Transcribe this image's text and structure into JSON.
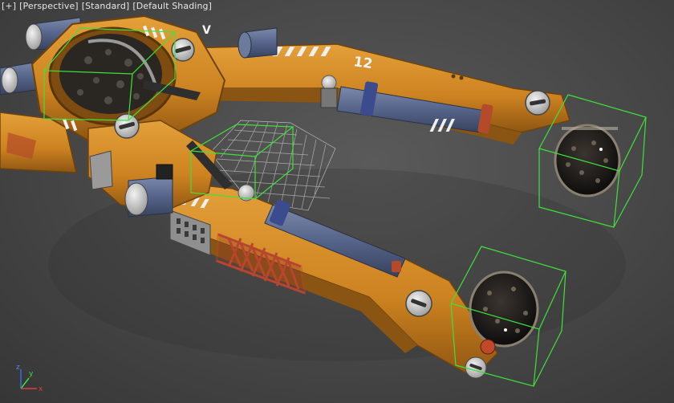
{
  "viewport": {
    "labels": {
      "menu": "[+]",
      "view": "[Perspective]",
      "shading_style": "[Standard]",
      "shading_mode": "[Default Shading]"
    },
    "model_decals": {
      "number": "12",
      "chevrons_left": "V",
      "chevrons_lower": "V"
    },
    "axis_gizmo": {
      "x": "x",
      "y": "y",
      "z": "z"
    },
    "colors": {
      "background": "#4a4a4a",
      "hull_orange": "#d38a22",
      "hull_shadow": "#9a5a14",
      "piston_blue": "#5c6b8f",
      "selection_green": "#38e23a",
      "grid_lines": "#bdbdbd",
      "frame_red": "#b8452e"
    }
  }
}
